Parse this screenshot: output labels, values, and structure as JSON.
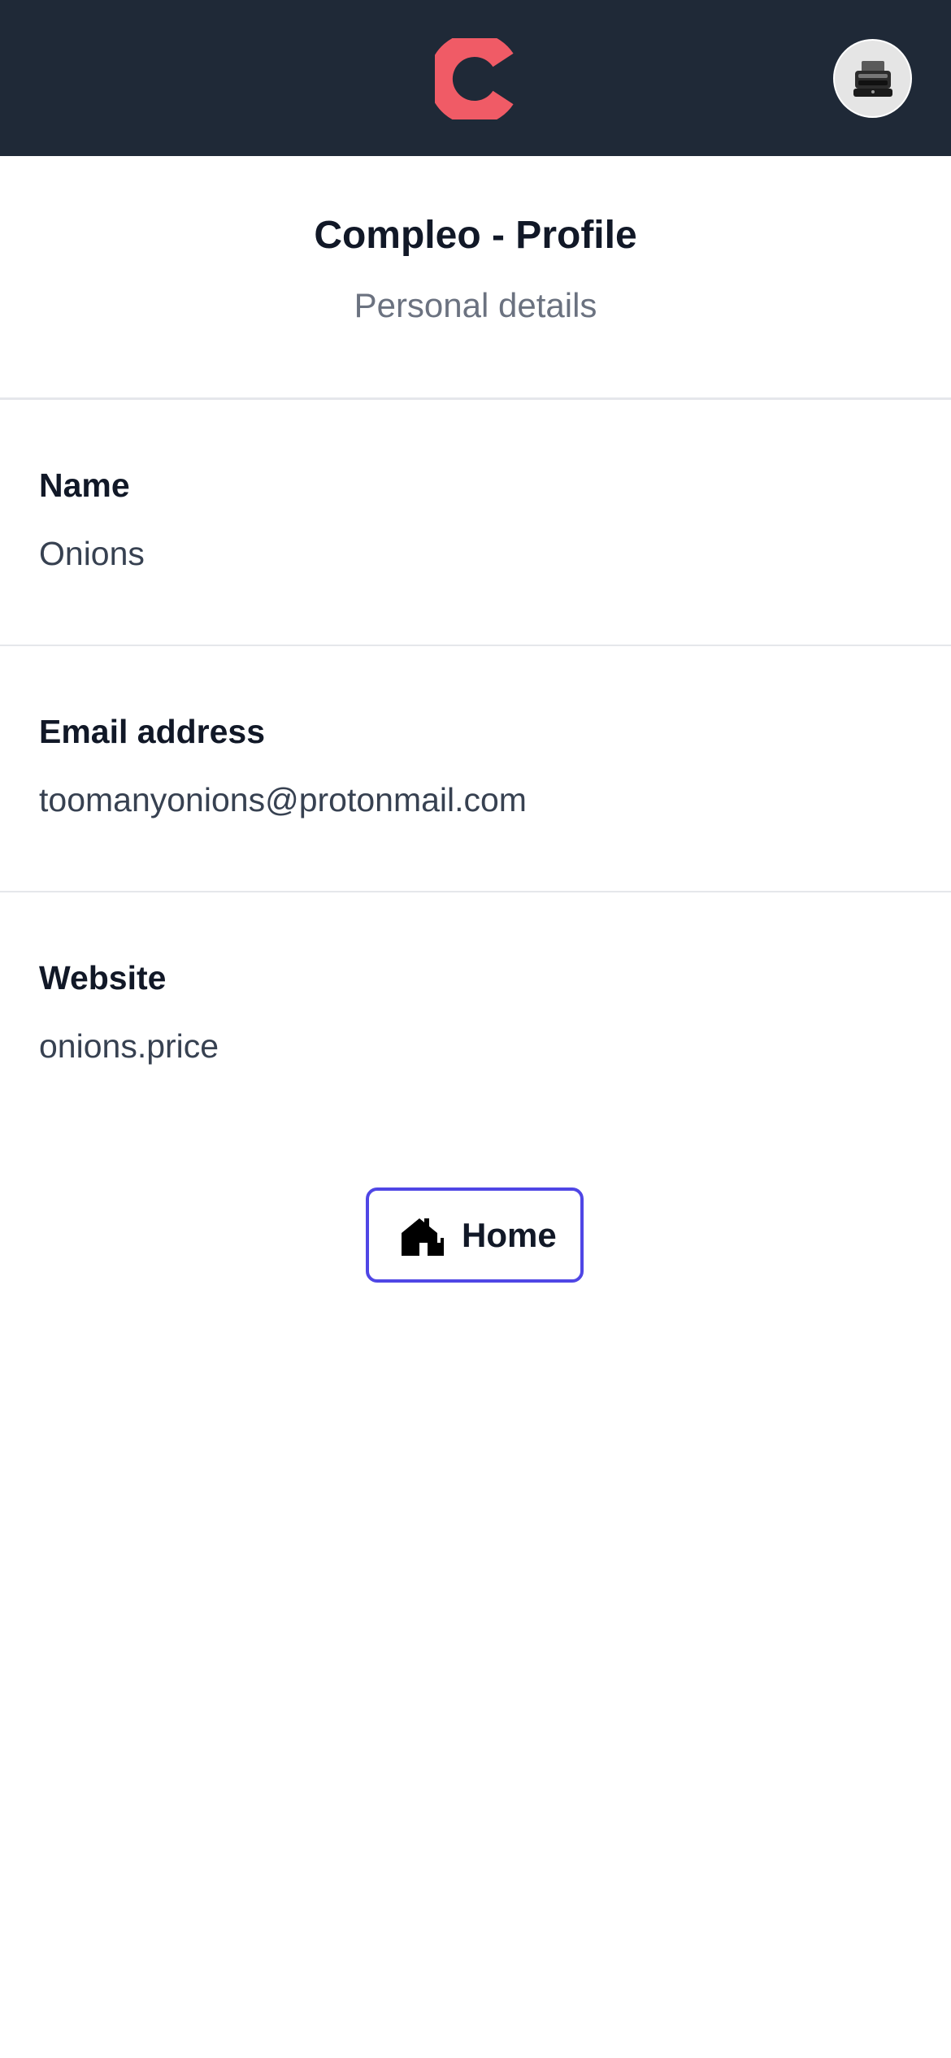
{
  "header": {
    "logo": "compleo-logo",
    "avatar": "typewriter-avatar"
  },
  "page": {
    "title": "Compleo - Profile",
    "subtitle": "Personal details"
  },
  "fields": [
    {
      "label": "Name",
      "value": "Onions"
    },
    {
      "label": "Email address",
      "value": "toomanyonions@protonmail.com"
    },
    {
      "label": "Website",
      "value": "onions.price"
    }
  ],
  "actions": {
    "home_label": "Home",
    "home_icon": "house-icon"
  },
  "colors": {
    "topbar": "#1f2937",
    "logo": "#f05b66",
    "button_border": "#4f46e5",
    "divider": "#e5e7eb"
  }
}
